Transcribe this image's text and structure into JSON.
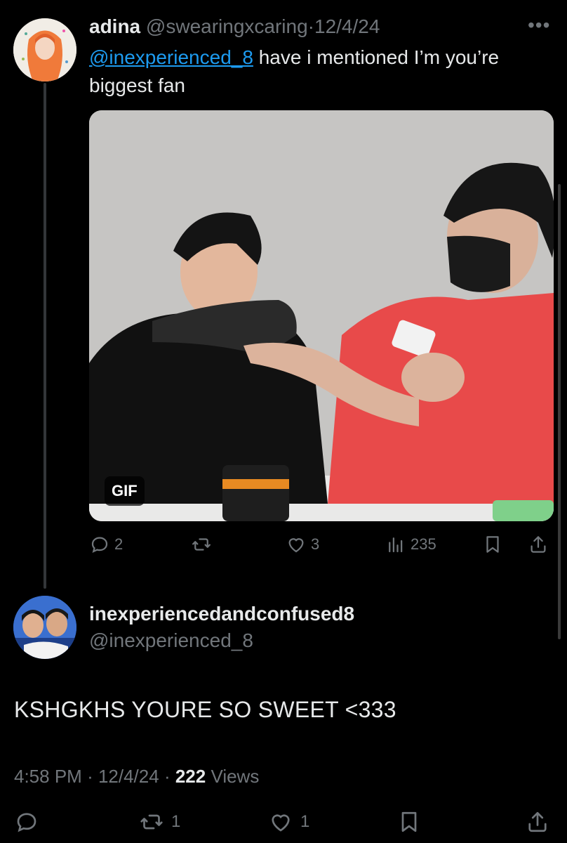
{
  "tweet": {
    "display_name": "adina",
    "handle": "@swearingxcaring",
    "date": "12/4/24",
    "more_icon": "more-horizontal-icon",
    "mention": "@inexperienced_8",
    "text_after_mention": " have i mentioned I’m you’re biggest fan",
    "media_badge": "GIF",
    "replies": "2",
    "likes": "3",
    "views": "235"
  },
  "reply": {
    "display_name": "inexperiencedandconfused8",
    "handle": "@inexperienced_8",
    "text": "KSHGKHS YOURE SO SWEET <333",
    "time": "4:58 PM",
    "date": "12/4/24",
    "views_count": "222",
    "views_label": "Views",
    "retweets": "1",
    "likes": "1"
  },
  "colors": {
    "background": "#000000",
    "text": "#e7e9ea",
    "muted": "#71767b",
    "link": "#1d9bf0"
  }
}
